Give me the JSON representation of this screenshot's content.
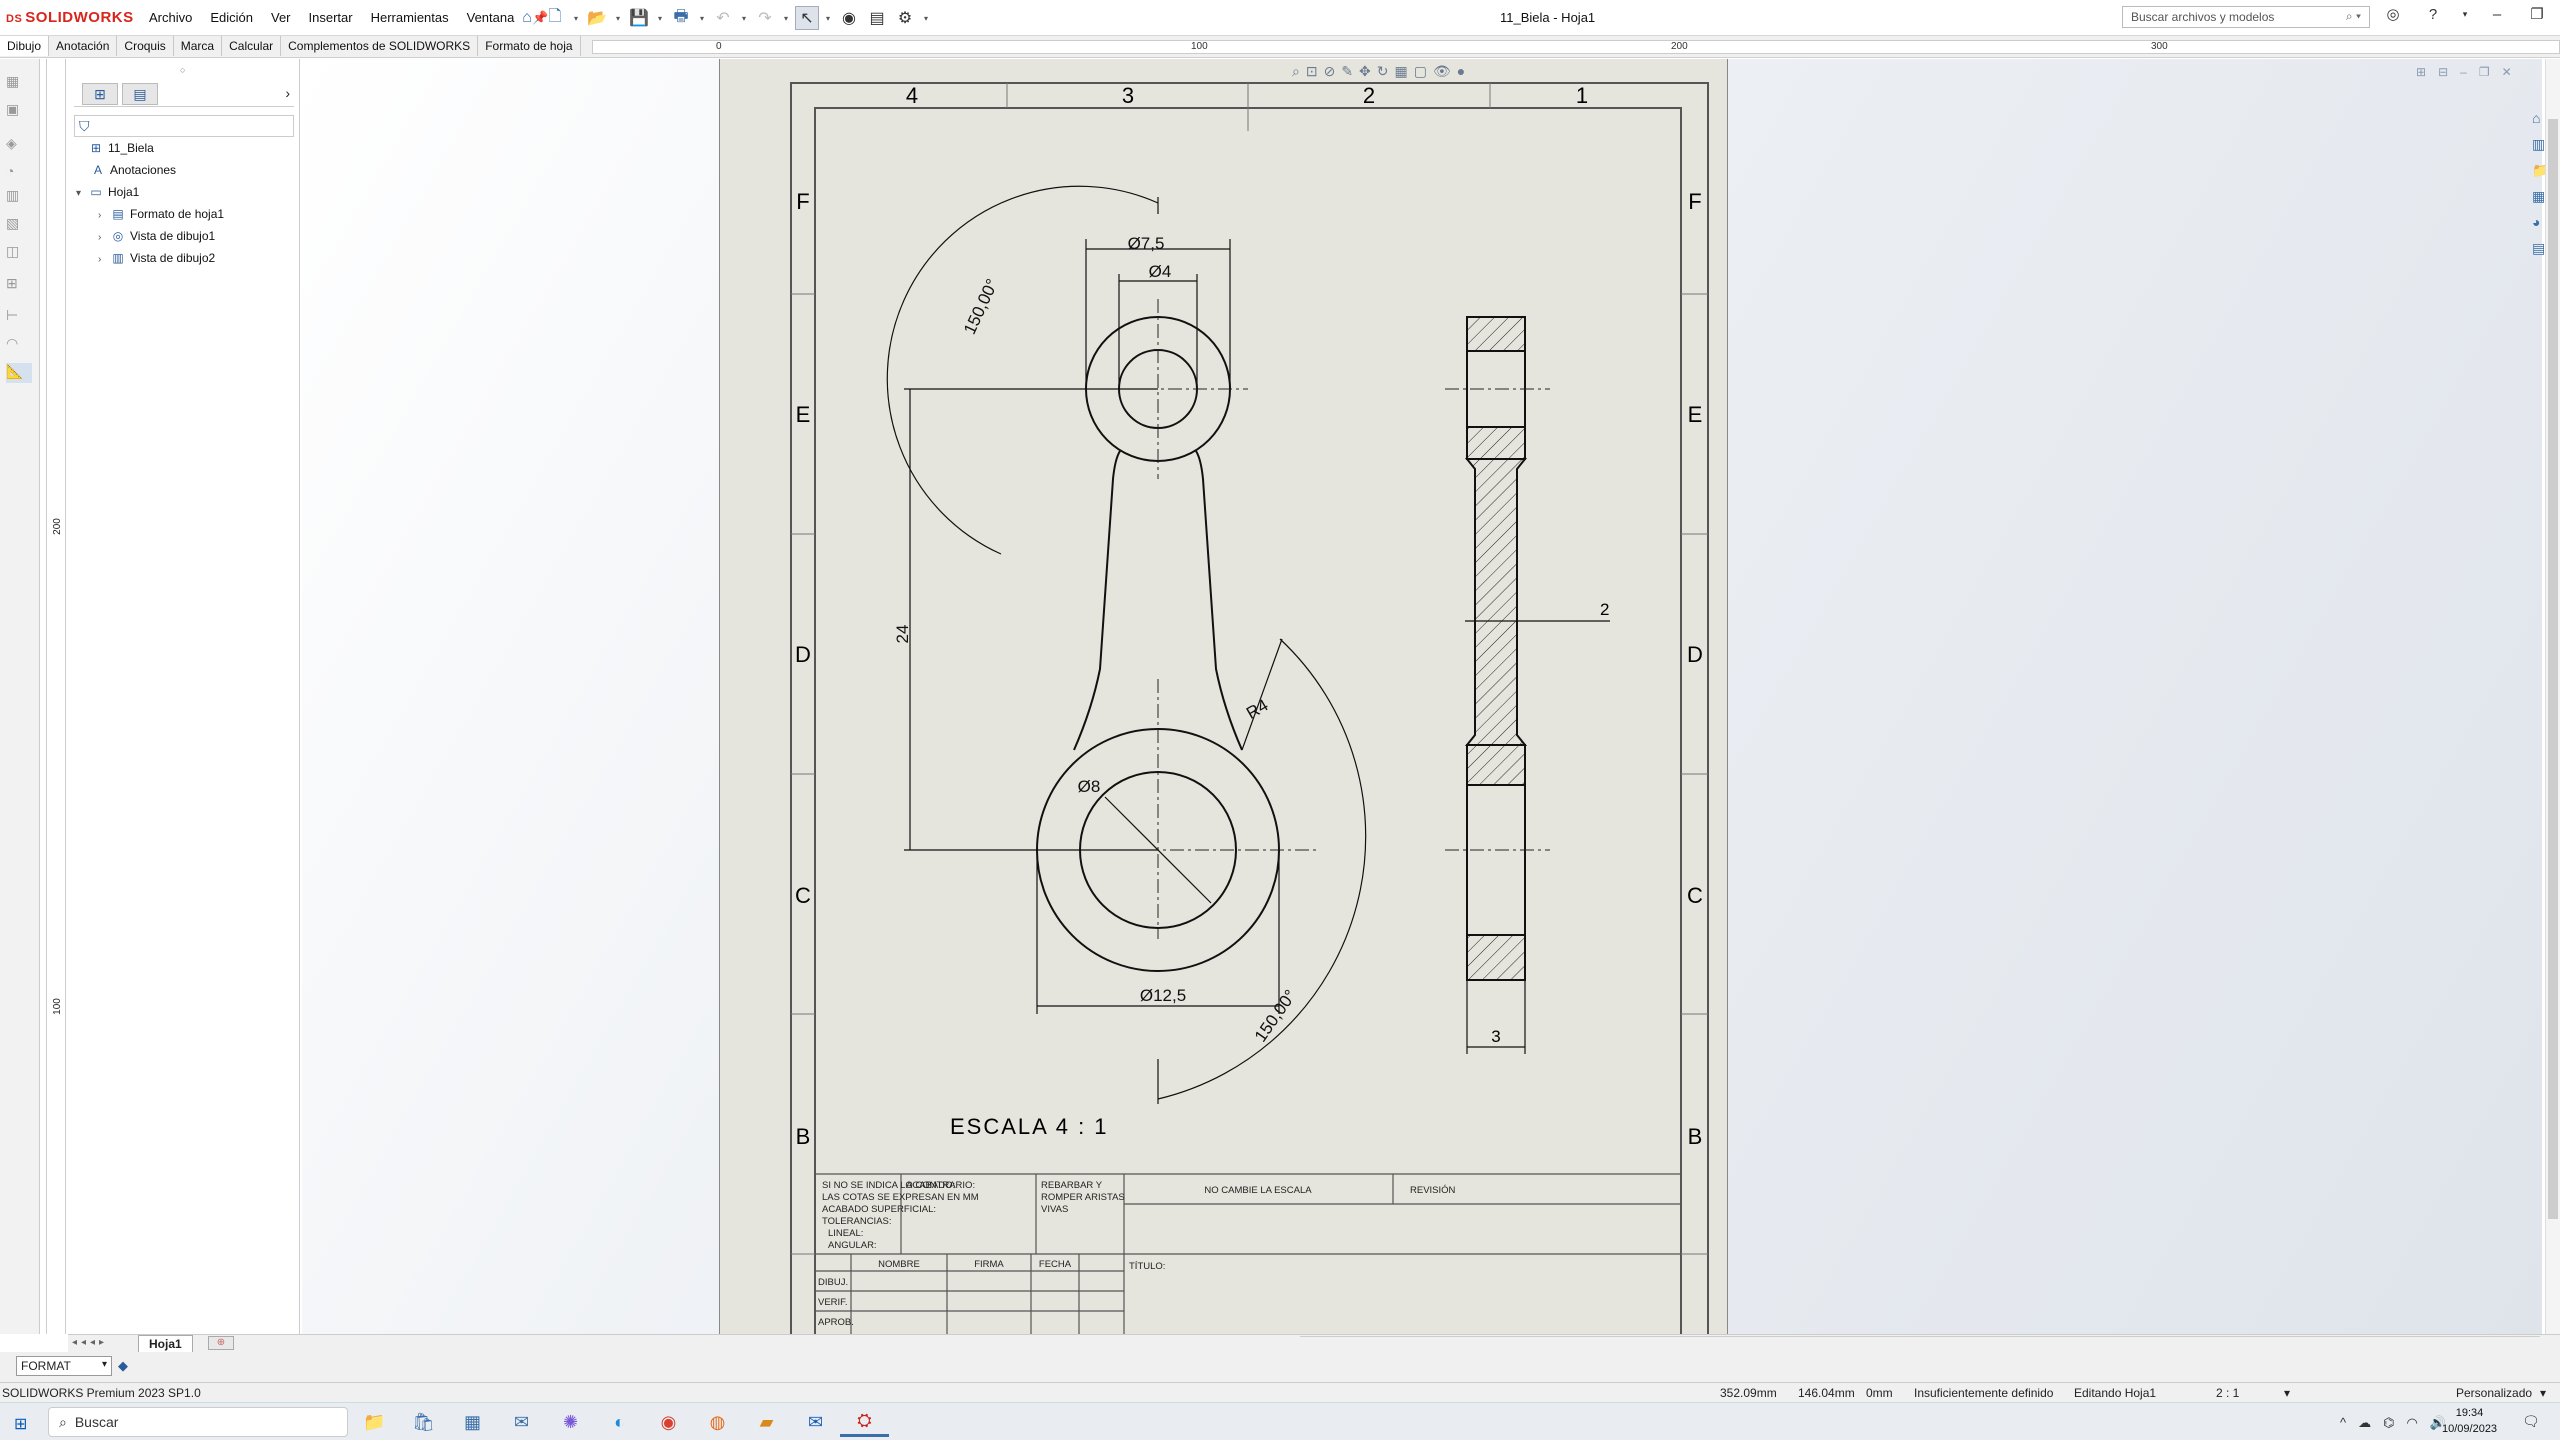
{
  "app": {
    "logo": "SOLIDWORKS",
    "document_title": "11_Biela - Hoja1"
  },
  "menu": [
    "Archivo",
    "Edición",
    "Ver",
    "Insertar",
    "Herramientas",
    "Ventana"
  ],
  "search": {
    "placeholder": "Buscar archivos y modelos"
  },
  "tabs": [
    "Dibujo",
    "Anotación",
    "Croquis",
    "Marca",
    "Calcular",
    "Complementos de SOLIDWORKS",
    "Formato de hoja"
  ],
  "ruler_top": [
    "0",
    "100",
    "200",
    "300"
  ],
  "ruler_left": [
    "200",
    "100"
  ],
  "feature_tree": [
    {
      "label": "11_Biela",
      "icon": "drawing-icon"
    },
    {
      "label": "Anotaciones",
      "icon": "annotations-icon"
    },
    {
      "label": "Hoja1",
      "icon": "sheet-icon"
    },
    {
      "label": "Formato de hoja1",
      "icon": "sheet-format-icon"
    },
    {
      "label": "Vista de dibujo1",
      "icon": "drawing-view-icon"
    },
    {
      "label": "Vista de dibujo2",
      "icon": "section-view-icon"
    }
  ],
  "drawing": {
    "col_labels": [
      "4",
      "3",
      "2",
      "1"
    ],
    "row_labels": [
      "F",
      "E",
      "D",
      "C",
      "B"
    ],
    "dimensions": {
      "d_top_outer": "Ø7,5",
      "d_top_inner": "Ø4",
      "d_bottom_inner": "Ø8",
      "d_bottom_outer": "Ø12,5",
      "angle_top": "150,00°",
      "angle_bottom": "150,00°",
      "center_distance": "24",
      "radius": "R4",
      "side_thickness": "2",
      "side_width": "3"
    },
    "scale": "ESCALA 4 : 1",
    "title_block": {
      "notes": [
        "SI NO SE INDICA LO CONTRARIO:",
        "LAS COTAS SE EXPRESAN EN MM",
        "ACABADO SUPERFICIAL:",
        "TOLERANCIAS:",
        "LINEAL:",
        "ANGULAR:"
      ],
      "acabado": "ACABADO:",
      "rebarbar": [
        "REBARBAR Y",
        "ROMPER ARISTAS",
        "VIVAS"
      ],
      "no_escala": "NO CAMBIE LA ESCALA",
      "revision": "REVISIÓN",
      "titulo": "TÍTULO:",
      "cols": [
        "NOMBRE",
        "FIRMA",
        "FECHA"
      ],
      "rows": [
        "DIBUJ.",
        "VERIF.",
        "APROB."
      ]
    }
  },
  "sheet_tab": "Hoja1",
  "layer": "FORMAT",
  "status": {
    "product": "SOLIDWORKS Premium 2023 SP1.0",
    "x": "352.09mm",
    "y": "146.04mm",
    "z": "0mm",
    "definition": "Insuficientemente definido",
    "editing": "Editando Hoja1",
    "scale": "2 : 1",
    "units": "Personalizado"
  },
  "taskbar": {
    "search": "Buscar",
    "time": "19:34",
    "date": "10/09/2023"
  }
}
